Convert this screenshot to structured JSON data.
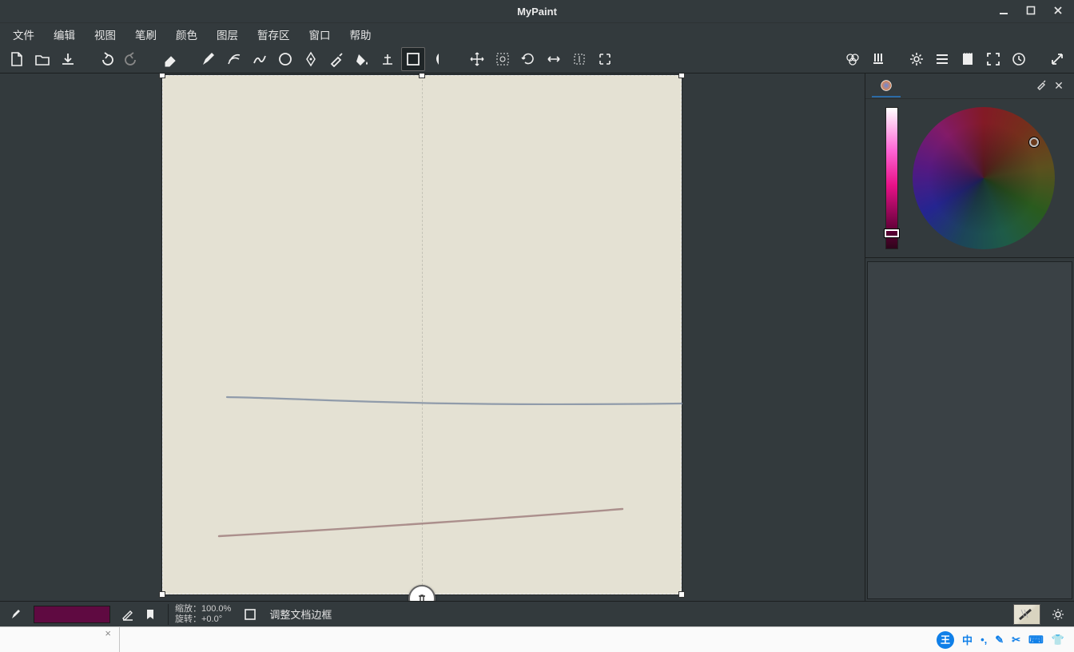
{
  "titlebar": {
    "title": "MyPaint"
  },
  "menubar": {
    "items": [
      "文件",
      "编辑",
      "视图",
      "笔刷",
      "颜色",
      "图层",
      "暂存区",
      "窗口",
      "帮助"
    ]
  },
  "toolbar": {
    "left_groups": [
      [
        "new-file-icon",
        "open-file-icon",
        "save-icon"
      ],
      [
        "undo-icon",
        "redo-icon"
      ],
      [
        "eraser-icon"
      ],
      [
        "brush-icon",
        "lines-icon",
        "freehand-curve-icon",
        "ellipse-icon",
        "ink-pen-icon",
        "color-picker-icon",
        "flood-fill-icon",
        "gradient-icon",
        "frame-icon",
        "symmetry-icon"
      ],
      [
        "move-icon",
        "zoom-fit-icon",
        "rotate-icon",
        "fit-width-icon",
        "fit-height-icon",
        "fit-screen-icon"
      ]
    ],
    "active_tool": "frame-icon",
    "right_groups": [
      [
        "color-swatches-icon",
        "brushes-panel-icon"
      ],
      [
        "settings-icon",
        "options-icon",
        "scratchpad-icon",
        "fullscreen-icon",
        "history-icon"
      ],
      [
        "expand-icon"
      ]
    ]
  },
  "status": {
    "zoom_label": "缩放：",
    "zoom_value": "100.0%",
    "rotation_label": "旋转：",
    "rotation_value": "+0.0°",
    "mode_label": "调整文档边框"
  },
  "color_panel": {
    "tab_name": "color-wheel-tab"
  },
  "taskbar": {
    "tray": [
      "中",
      "•,",
      "✎",
      "✂",
      "⌨",
      "👕"
    ]
  }
}
